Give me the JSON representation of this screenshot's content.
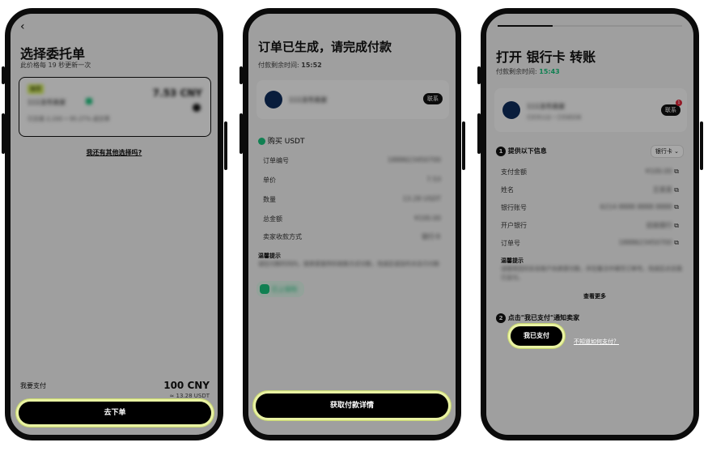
{
  "screen1": {
    "back_icon": "‹",
    "title": "选择委托单",
    "subtitle": "此价格每 19 秒更新一次",
    "card_tag": "推荐",
    "card_seller": "111法币商家",
    "card_price": "7.53 CNY",
    "card_stats": "已交易 2,193 • 95.27% 成交率",
    "other_choice": "我还有其他选择吗?",
    "pay_label": "我要支付",
    "pay_amount": "100 CNY",
    "pay_sub": "≈ 13.28 USDT",
    "submit_button": "去下单"
  },
  "screen2": {
    "title": "订单已生成，请完成付款",
    "timer_label": "付款剩余时间:",
    "timer_value": "15:52",
    "seller": "111法币商家",
    "chat_button": "联系",
    "buy_label": "购买 USDT",
    "rows": [
      {
        "label": "订单编号",
        "value": "1888623450700"
      },
      {
        "label": "单价",
        "value": "7.53"
      },
      {
        "label": "数量",
        "value": "13.28 USDT"
      },
      {
        "label": "总金额",
        "value": "¥100.00"
      },
      {
        "label": "卖家收款方式",
        "value": "银行卡"
      }
    ],
    "notice_title": "温馨提示",
    "notice_text": "请在付款时间内，按卖家提供的收款方式付款，完成后请及时点击已付款",
    "badge_text": "已上保险",
    "detail_button": "获取付款详情"
  },
  "screen3": {
    "title": "打开 银行卡 转账",
    "timer_label": "付款剩余时间:",
    "timer_value": "15:43",
    "seller": "111法币商家",
    "seller_sub": "已实名认证 • 已完成交易",
    "chat_button": "联系",
    "chat_badge": "1",
    "step1_num": "1",
    "step1_title": "提供以下信息",
    "method": "银行卡",
    "rows": [
      {
        "label": "支付金额",
        "value": "¥100.00"
      },
      {
        "label": "姓名",
        "value": "王某某"
      },
      {
        "label": "银行账号",
        "value": "6214 8888 8888 8888"
      },
      {
        "label": "开户银行",
        "value": "招商银行"
      },
      {
        "label": "订单号",
        "value": "1888623450700"
      }
    ],
    "notice_title": "温馨提示",
    "notice_text": "请使用您的实名账户向卖家付款，并在备注中填写订单号。完成后点击我已支付。",
    "notice_link": "查看更多",
    "step2_num": "2",
    "step2_title": "点击\"我已支付\"通知卖家",
    "paid_button": "我已支付",
    "help_link": "不知道如何支付？"
  },
  "colors": {
    "accent_green": "#19c37d",
    "highlight": "#e9f2a3"
  }
}
